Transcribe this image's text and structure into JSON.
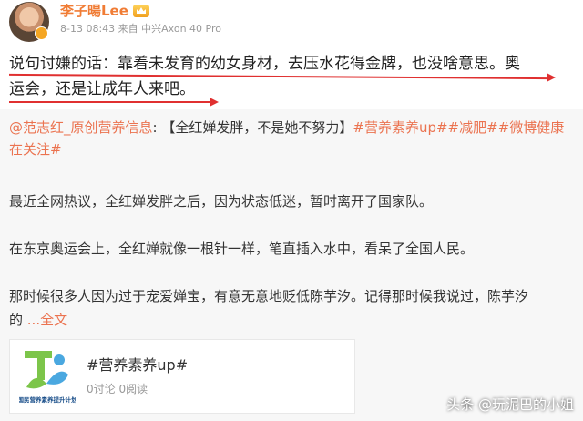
{
  "header": {
    "username": "李子暘Lee",
    "meta": "8-13 08:43 来自 中兴Axon 40 Pro",
    "vip_icon": "vip-crown-icon"
  },
  "post": {
    "line1": "说句讨嫌的话：靠着未发育的幼女身材，去压水花得金牌，也没啥意思。奥",
    "line2": "运会，还是让成年人来吧。"
  },
  "repost": {
    "author_link": "@范志红_原创营养信息",
    "colon": ":",
    "quote": "【全红婵发胖，不是她不努力】",
    "tags": [
      "#营养素养up#",
      "#减肥#",
      "#微博健康在关注#"
    ],
    "para1": "最近全网热议，全红婵发胖之后，因为状态低迷，暂时离开了国家队。",
    "para2": "在东京奥运会上，全红婵就像一根针一样，笔直插入水中，看呆了全国人民。",
    "para3_line1": "那时候很多人因为过于宠爱婵宝，有意无意地贬低陈芋汐。记得那时候我说过，陈芋汐",
    "para3_line2": "的 ",
    "more_label": "...全文"
  },
  "card": {
    "title": "#营养素养up#",
    "stats": "0讨论 0阅读",
    "logo_text": "国民营养素养提升计划"
  },
  "watermark": "头条 @玩泥巴的小姐",
  "colors": {
    "accent": "#eb7350",
    "username": "#f07c35",
    "underline": "#e03030"
  }
}
